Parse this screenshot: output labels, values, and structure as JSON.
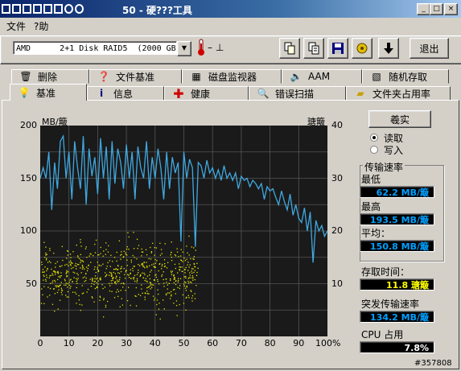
{
  "app": {
    "logo_text": "MOBILE",
    "title": "50 - 硬???工具"
  },
  "titlebar_buttons": [
    "_",
    "□",
    "×"
  ],
  "menu": [
    "文件",
    "?助"
  ],
  "toolbar": {
    "drive": "AMD      2+1 Disk RAID5  (2000 GB)",
    "temp": "– ⊥",
    "exit_label": "退出",
    "icons": [
      "copy-icon",
      "copy-text-icon",
      "save-icon",
      "options-icon",
      "down-arrow-icon"
    ]
  },
  "tabs_back": [
    {
      "label": "删除",
      "icon": "trash-icon"
    },
    {
      "label": "文件基准",
      "icon": "file-benchmark-icon"
    },
    {
      "label": "磁盘监视器",
      "icon": "monitor-icon"
    },
    {
      "label": "AAM",
      "icon": "speaker-icon"
    },
    {
      "label": "随机存取",
      "icon": "random-access-icon"
    }
  ],
  "tabs_front": [
    {
      "label": "基准",
      "icon": "bulb-icon",
      "active": true
    },
    {
      "label": "信息",
      "icon": "info-icon"
    },
    {
      "label": "健康",
      "icon": "health-cross-icon"
    },
    {
      "label": "错误扫描",
      "icon": "magnifier-icon"
    },
    {
      "label": "文件夹占用率",
      "icon": "folder-icon"
    }
  ],
  "controls": {
    "start_button": "羲实",
    "radio_read": "读取",
    "radio_write": "写入",
    "read_selected": true
  },
  "stats": {
    "transfer_rate_title": "传输速率",
    "min_label": "最低",
    "min_value": "62.2 MB/簸",
    "max_label": "最高",
    "max_value": "193.5 MB/簸",
    "avg_label": "平均：",
    "avg_value": "150.8 MB/簸",
    "access_label": "存取时间：",
    "access_value": "11.8 瑭簸",
    "burst_label": "突发传输速率",
    "burst_value": "134.2 MB/簸",
    "cpu_label": "CPU 占用",
    "cpu_value": "7.8%"
  },
  "watermark": "#357808",
  "colors": {
    "line": "#3fa8e0",
    "scatter": "#e6e600",
    "chart_bg": "#1a1a1a",
    "grid": "#555555"
  },
  "chart_data": {
    "type": "line",
    "y_left_unit": "MB/簸",
    "y_right_unit": "瑭簸",
    "y_left_ticks": [
      "200",
      "150",
      "100",
      "50"
    ],
    "y_left_range": [
      0,
      200
    ],
    "y_right_ticks": [
      "40",
      "30",
      "20",
      "10"
    ],
    "y_right_range": [
      0,
      40
    ],
    "x_ticks": [
      "0",
      "10",
      "20",
      "30",
      "40",
      "50",
      "60",
      "70",
      "80",
      "90",
      "100%"
    ],
    "x_range": [
      0,
      100
    ],
    "grid": true,
    "series": [
      {
        "name": "transfer_rate",
        "axis": "left",
        "x": [
          0,
          1,
          2,
          3,
          4,
          5,
          6,
          7,
          8,
          9,
          10,
          11,
          12,
          13,
          14,
          15,
          16,
          17,
          18,
          19,
          20,
          21,
          22,
          23,
          24,
          25,
          26,
          27,
          28,
          29,
          30,
          31,
          32,
          33,
          34,
          35,
          36,
          37,
          38,
          39,
          40,
          41,
          42,
          43,
          44,
          45,
          46,
          47,
          48,
          49,
          50,
          51,
          52,
          53,
          54,
          55,
          56,
          57,
          58,
          59,
          60,
          61,
          62,
          63,
          64,
          65,
          66,
          67,
          68,
          69,
          70,
          71,
          72,
          73,
          74,
          75,
          76,
          77,
          78,
          79,
          80,
          81,
          82,
          83,
          84,
          85,
          86,
          87,
          88,
          89,
          90,
          91,
          92,
          93,
          94,
          95,
          96,
          97,
          98,
          99,
          100
        ],
        "y": [
          150,
          160,
          150,
          175,
          120,
          165,
          140,
          185,
          190,
          150,
          175,
          130,
          185,
          160,
          140,
          190,
          125,
          178,
          152,
          170,
          135,
          188,
          150,
          180,
          130,
          185,
          145,
          178,
          165,
          140,
          182,
          150,
          175,
          130,
          180,
          160,
          150,
          185,
          140,
          170,
          150,
          178,
          160,
          130,
          175,
          140,
          170,
          155,
          165,
          90,
          175,
          150,
          168,
          160,
          85,
          165,
          162,
          150,
          167,
          155,
          160,
          150,
          158,
          148,
          162,
          150,
          155,
          148,
          155,
          140,
          152,
          148,
          150,
          142,
          148,
          145,
          140,
          145,
          130,
          142,
          138,
          140,
          132,
          125,
          138,
          128,
          120,
          135,
          115,
          125,
          112,
          108,
          122,
          100,
          118,
          70,
          110,
          100,
          105,
          95,
          100
        ]
      },
      {
        "name": "access_time",
        "axis": "right",
        "type": "scatter",
        "x_range": [
          0,
          55
        ],
        "y_center": 11.8,
        "count": 700
      }
    ]
  }
}
